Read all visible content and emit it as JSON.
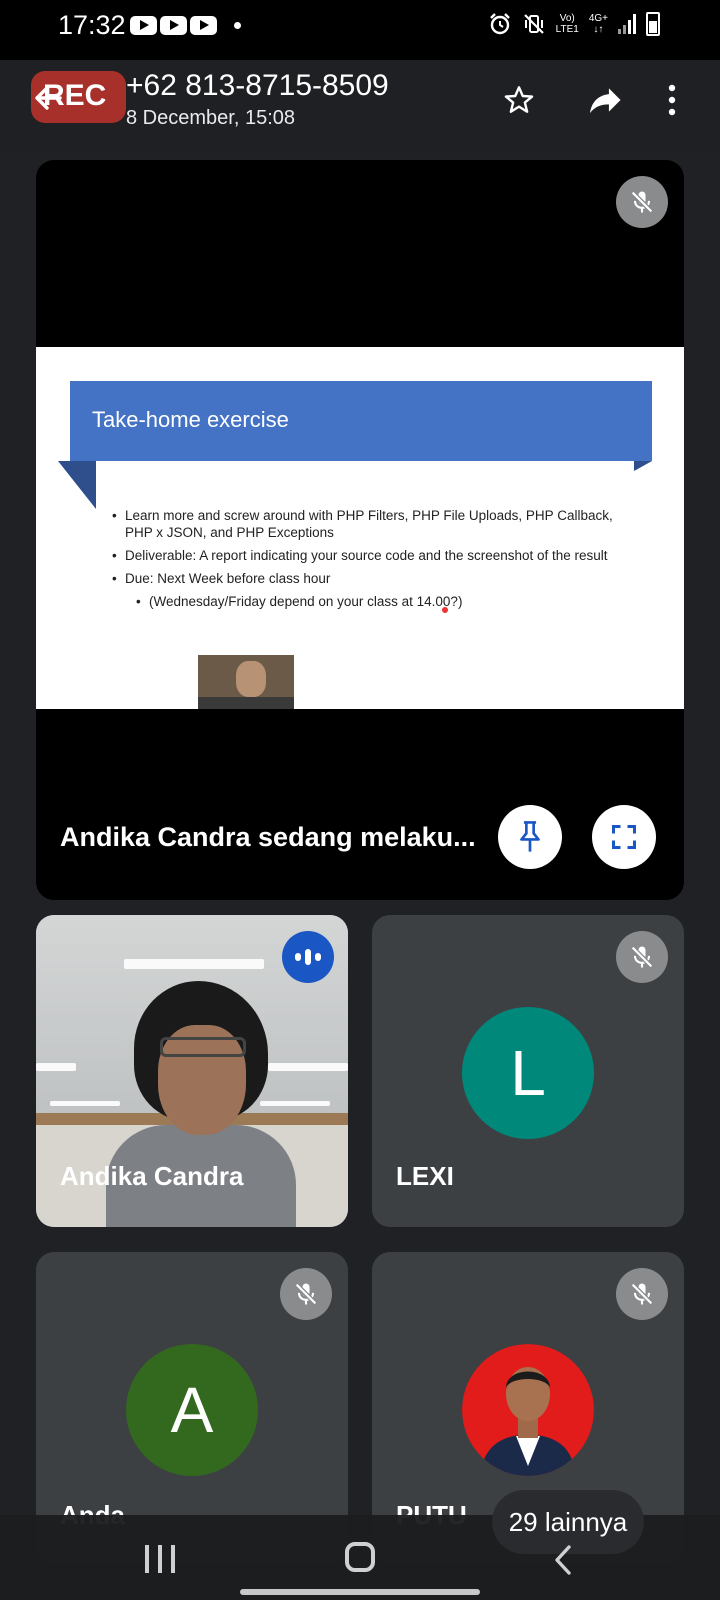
{
  "status_bar": {
    "time": "17:32",
    "network_top": "Vo)",
    "network_bottom": "LTE1",
    "network_type": "4G+"
  },
  "header": {
    "rec_label": "REC",
    "title": "+62 813-8715-8509",
    "subtitle": "8 December, 15:08"
  },
  "presentation": {
    "slide_title": "Take-home exercise",
    "bullets": [
      "Learn more and screw around with PHP Filters, PHP File Uploads, PHP Callback, PHP x JSON, and PHP Exceptions",
      "Deliverable: A report indicating your source code and the screenshot of the result",
      "Due: Next Week before class hour"
    ],
    "sub_bullet": "(Wednesday/Friday depend on your class at 14.00?)",
    "caption": "Andika Candra sedang melaku..."
  },
  "participants": [
    {
      "name": "Andika Candra"
    },
    {
      "name": "LEXI",
      "initial": "L",
      "color": "#00897b"
    },
    {
      "name": "Anda",
      "initial": "A",
      "color": "#33691e"
    },
    {
      "name": "PUTU"
    }
  ],
  "more_participants": "29 lainnya",
  "colors": {
    "rec": "#a8302b",
    "speaking_badge": "#1a57c4",
    "slide_banner": "#4472c4"
  }
}
